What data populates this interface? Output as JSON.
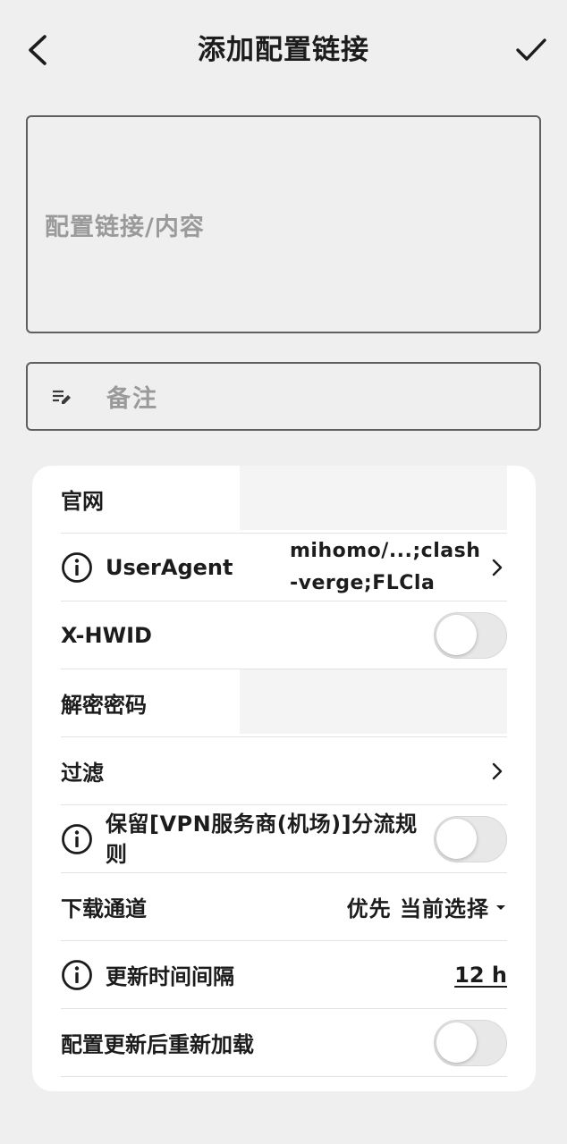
{
  "appbar": {
    "title": "添加配置链接",
    "back_icon": "chevron-left-icon",
    "confirm_icon": "check-icon"
  },
  "url_field": {
    "placeholder": "配置链接/内容",
    "value": ""
  },
  "remark_field": {
    "icon": "edit-note-icon",
    "placeholder": "备注",
    "value": ""
  },
  "settings": {
    "website": {
      "label": "官网",
      "value": ""
    },
    "user_agent": {
      "label": "UserAgent",
      "value": "mihomo/...;clash-verge;FLCla",
      "icon": "info-icon"
    },
    "x_hwid": {
      "label": "X-HWID",
      "enabled": false
    },
    "decrypt_password": {
      "label": "解密密码",
      "value": ""
    },
    "filter": {
      "label": "过滤"
    },
    "keep_rules": {
      "label": "保留[VPN服务商(机场)]分流规则",
      "enabled": false,
      "icon": "info-icon"
    },
    "download_channel": {
      "label": "下载通道",
      "value": "优先 当前选择"
    },
    "update_interval": {
      "label": "更新时间间隔",
      "value": "12 h",
      "icon": "info-icon"
    },
    "reload_after_update": {
      "label": "配置更新后重新加载",
      "enabled": false
    }
  },
  "colors": {
    "background": "#efefef",
    "card": "#ffffff",
    "text": "#1c1c1c",
    "placeholder": "#9a9a9a",
    "border": "#5f5f5f"
  }
}
